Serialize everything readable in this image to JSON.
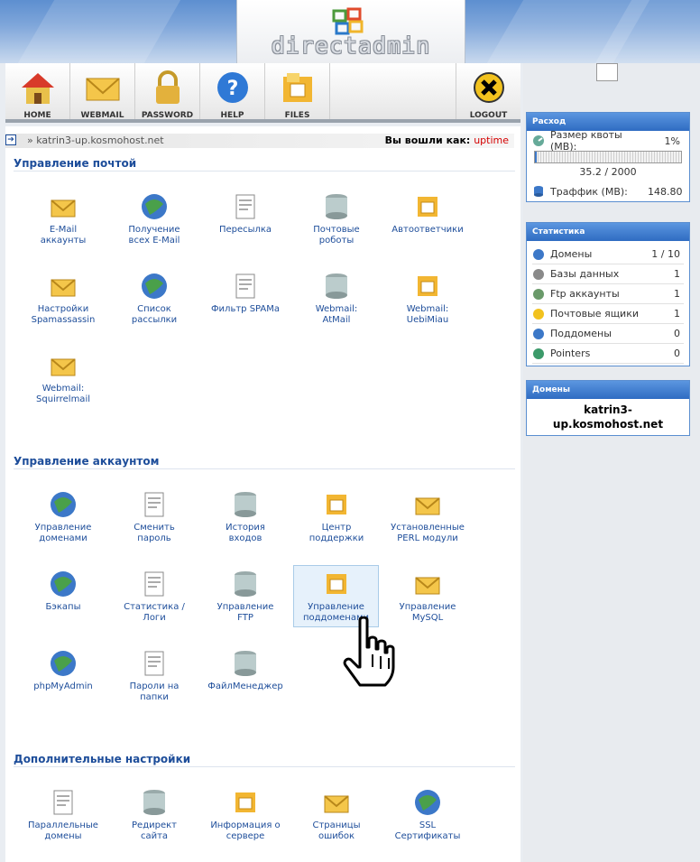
{
  "brand": {
    "name": "directadmin"
  },
  "toolbar": [
    {
      "key": "home",
      "label": "HOME",
      "icon": "home-icon"
    },
    {
      "key": "webmail",
      "label": "WEBMAIL",
      "icon": "envelope-icon"
    },
    {
      "key": "password",
      "label": "PASSWORD",
      "icon": "lock-icon"
    },
    {
      "key": "help",
      "label": "HELP",
      "icon": "help-icon"
    },
    {
      "key": "files",
      "label": "FILES",
      "icon": "files-icon"
    },
    {
      "key": "logout",
      "label": "LOGOUT",
      "icon": "close-icon"
    }
  ],
  "breadcrumb": {
    "path": "katrin3-up.kosmohost.net",
    "logged_in_label": "Вы вошли как:",
    "username": "uptime"
  },
  "sections": [
    {
      "title": "Управление почтой",
      "items": [
        [
          "E-Mail",
          "аккаунты"
        ],
        [
          "Получение",
          "всех E-Mail"
        ],
        [
          "Пересылка",
          ""
        ],
        [
          "Почтовые",
          "роботы"
        ],
        [
          "Автоответчики",
          ""
        ],
        [
          "Настройки",
          "Spamassassin"
        ],
        [
          "Список",
          "рассылки"
        ],
        [
          "Фильтр SPAMa",
          ""
        ],
        [
          "Webmail:",
          "AtMail"
        ],
        [
          "Webmail:",
          "UebiMiau"
        ],
        [
          "Webmail:",
          "Squirrelmail"
        ]
      ]
    },
    {
      "title": "Управление аккаунтом",
      "items": [
        [
          "Управление",
          "доменами"
        ],
        [
          "Сменить",
          "пароль"
        ],
        [
          "История",
          "входов"
        ],
        [
          "Центр",
          "поддержки"
        ],
        [
          "Установленные",
          "PERL модули"
        ],
        [
          "Бэкапы",
          ""
        ],
        [
          "Статистика /",
          "Логи"
        ],
        [
          "Управление",
          "FTP"
        ],
        [
          "Управление",
          "поддоменами"
        ],
        [
          "Управление",
          "MySQL"
        ],
        [
          "phpMyAdmin",
          ""
        ],
        [
          "Пароли на",
          "папки"
        ],
        [
          "ФайлМенеджер",
          ""
        ]
      ]
    },
    {
      "title": "Дополнительные настройки",
      "items": [
        [
          "Параллельные",
          "домены"
        ],
        [
          "Редирект",
          "сайта"
        ],
        [
          "Информация о",
          "сервере"
        ],
        [
          "Страницы",
          "ошибок"
        ],
        [
          "SSL",
          "Сертификаты"
        ]
      ]
    }
  ],
  "usage": {
    "title": "Расход",
    "quota_label": "Размер квоты (MB):",
    "quota_percent": "1%",
    "quota_fraction": 0.01,
    "quota_values": "35.2 / 2000",
    "traffic_label": "Траффик (MB):",
    "traffic_value": "148.80"
  },
  "stats": {
    "title": "Статистика",
    "rows": [
      {
        "label": "Домены",
        "value": "1 / 10"
      },
      {
        "label": "Базы данных",
        "value": "1"
      },
      {
        "label": "Ftp аккаунты",
        "value": "1"
      },
      {
        "label": "Почтовые ящики",
        "value": "1"
      },
      {
        "label": "Поддомены",
        "value": "0"
      },
      {
        "label": "Pointers",
        "value": "0"
      }
    ]
  },
  "domains": {
    "title": "Домены",
    "name": "katrin3-up.kosmohost.net"
  },
  "colors": {
    "accent": "#1d4d9a",
    "header": "#3f78c8",
    "highlight": "#e6f1fb"
  }
}
